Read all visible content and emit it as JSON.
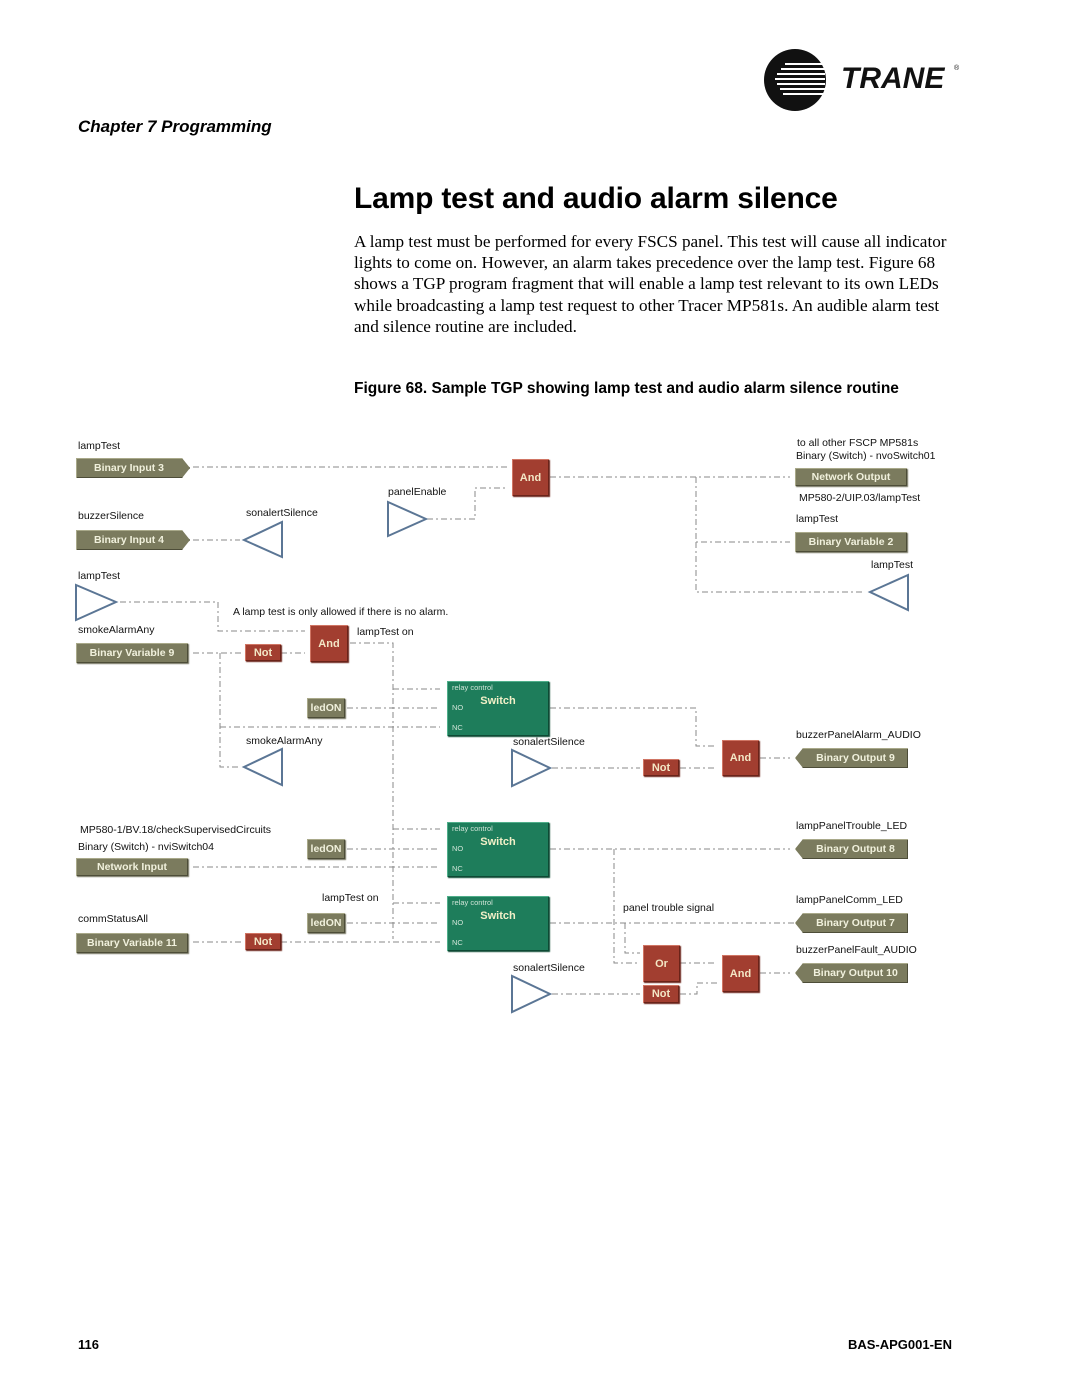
{
  "header": {
    "brand": "TRANE",
    "registered_mark": "®",
    "chapter": "Chapter 7 Programming"
  },
  "section": {
    "title": "Lamp test and audio alarm silence",
    "body": "A lamp test must be performed for every FSCS panel. This test will cause all indicator lights to come on. However, an alarm takes precedence over the lamp test. Figure 68 shows a TGP program fragment that will enable a lamp test relevant to its own LEDs while broadcasting a lamp test request to other Tracer MP581s. An audible alarm test and silence routine are included.",
    "figure_caption": "Figure 68.  Sample TGP showing lamp test and audio alarm silence routine"
  },
  "diagram": {
    "labels": {
      "lamptest_1": "lampTest",
      "buzzer_silence": "buzzerSilence",
      "sonalert_silence_1": "sonalertSilence",
      "panel_enable": "panelEnable",
      "to_all_other": "to all other FSCP MP581s",
      "binary_switch_nvo": "Binary (Switch) - nvoSwitch01",
      "mp580_2": "MP580-2/UIP.03/lampTest",
      "lamptest_2": "lampTest",
      "lamptest_3": "lampTest",
      "lamptest_4": "lampTest",
      "note": "A lamp test is only allowed if there is no alarm.",
      "smoke_alarm_1": "smokeAlarmAny",
      "lamptest_on_1": "lampTest on",
      "smoke_alarm_2": "smokeAlarmAny",
      "sonalert_silence_2": "sonalertSilence",
      "buzzer_panel_alarm": "buzzerPanelAlarm_AUDIO",
      "mp580_1": "MP580-1/BV.18/checkSupervisedCircuits",
      "binary_switch_nvi": "Binary (Switch) - nviSwitch04",
      "lamp_panel_trouble": "lampPanelTrouble_LED",
      "lamptest_on_2": "lampTest on",
      "comm_status_all": "commStatusAll",
      "panel_trouble_signal": "panel trouble signal",
      "lamp_panel_comm": "lampPanelComm_LED",
      "buzzer_panel_fault": "buzzerPanelFault_AUDIO",
      "sonalert_silence_3": "sonalertSilence"
    },
    "blocks": {
      "binary_input_3": "Binary Input 3",
      "binary_input_4": "Binary Input 4",
      "binary_variable_9": "Binary Variable 9",
      "network_input": "Network Input",
      "binary_variable_11": "Binary Variable 11",
      "network_output": "Network Output",
      "binary_variable_2": "Binary Variable 2",
      "binary_output_9": "Binary Output 9",
      "binary_output_8": "Binary Output 8",
      "binary_output_7": "Binary Output 7",
      "binary_output_10": "Binary Output 10",
      "led_on_1": "ledON",
      "led_on_2": "ledON",
      "led_on_3": "ledON",
      "and_1": "And",
      "and_2": "And",
      "and_3": "And",
      "and_4": "And",
      "not_1": "Not",
      "not_2": "Not",
      "not_3": "Not",
      "not_4": "Not",
      "or_1": "Or",
      "switch_title": "Switch",
      "pin_relay": "relay control",
      "pin_no": "NO",
      "pin_nc": "NC"
    },
    "colors": {
      "olive_block": "#7b7b5e",
      "logic_block": "#a23e30",
      "switch_block": "#1e7d5b",
      "triangle": "#5b7695",
      "wire": "#8a8a8a"
    }
  },
  "footer": {
    "page_number": "116",
    "doc_id": "BAS-APG001-EN"
  }
}
